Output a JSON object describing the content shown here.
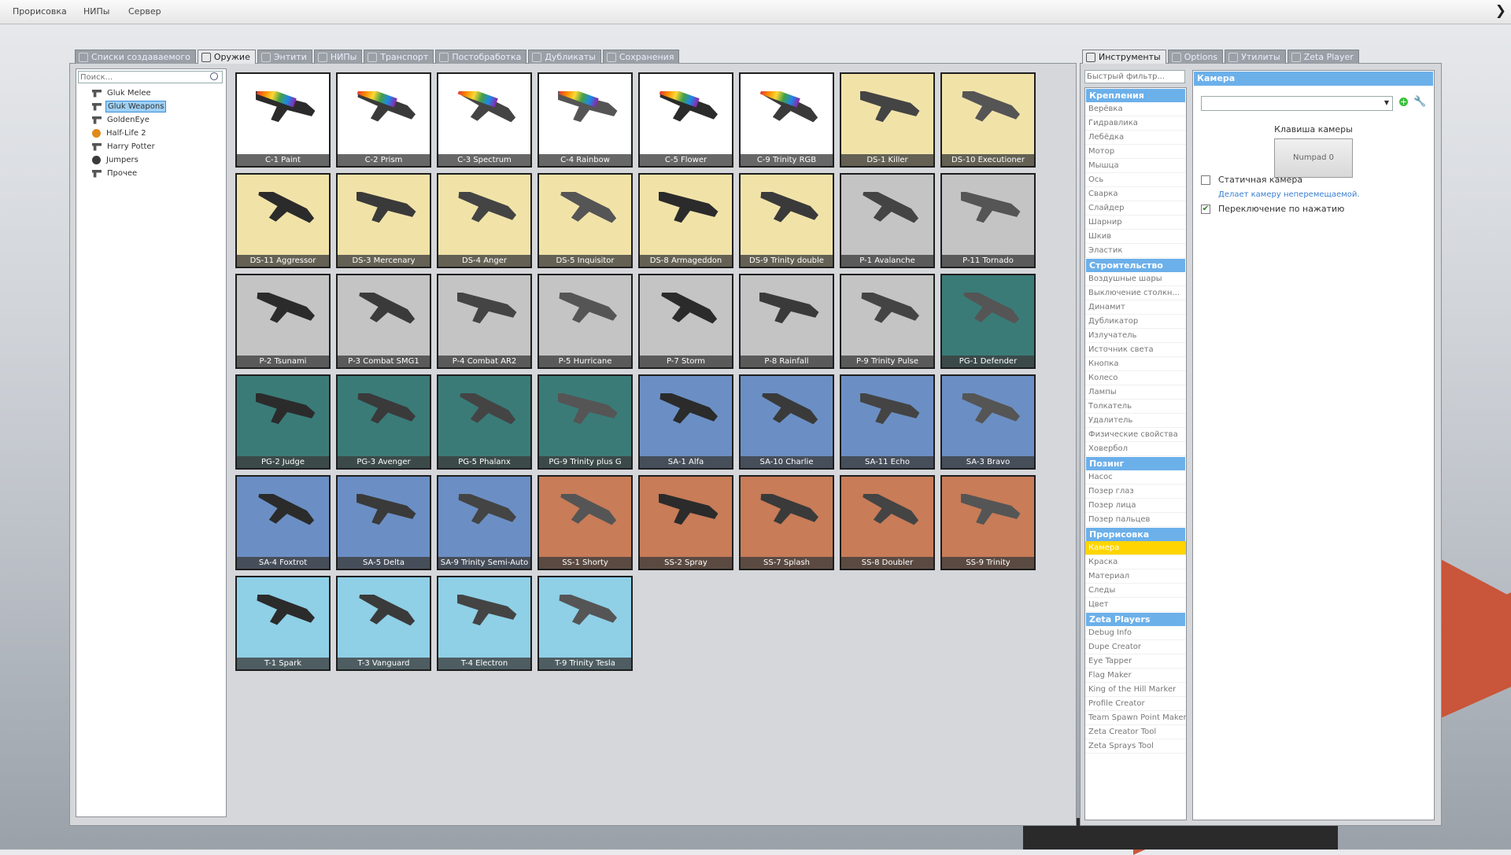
{
  "menubar": {
    "items": [
      "Прорисовка",
      "НИПы",
      "Сервер"
    ]
  },
  "spawnmenu": {
    "tabs": [
      "Списки создаваемого",
      "Оружие",
      "Энтити",
      "НИПы",
      "Транспорт",
      "Постобработка",
      "Дубликаты",
      "Сохранения"
    ],
    "active_tab": "Оружие",
    "search_placeholder": "Поиск...",
    "tree": [
      {
        "label": "Gluk Melee",
        "icon": "gun-icon"
      },
      {
        "label": "Gluk Weapons",
        "icon": "gun-icon",
        "selected": true
      },
      {
        "label": "GoldenEye",
        "icon": "gun-icon"
      },
      {
        "label": "Half-Life 2",
        "icon": "lambda-icon"
      },
      {
        "label": "Harry Potter",
        "icon": "gun-icon"
      },
      {
        "label": "Jumpers",
        "icon": "bomb-icon"
      },
      {
        "label": "Прочее",
        "icon": "gun-icon"
      }
    ],
    "weapons": [
      {
        "name": "C-1 Paint",
        "bg": "#ffffff"
      },
      {
        "name": "C-2 Prism",
        "bg": "#ffffff"
      },
      {
        "name": "C-3 Spectrum",
        "bg": "#ffffff"
      },
      {
        "name": "C-4 Rainbow",
        "bg": "#ffffff"
      },
      {
        "name": "C-5 Flower",
        "bg": "#ffffff"
      },
      {
        "name": "C-9 Trinity RGB",
        "bg": "#ffffff"
      },
      {
        "name": "DS-1 Killer",
        "bg": "#f1e3a8"
      },
      {
        "name": "DS-10 Executioner",
        "bg": "#f1e3a8"
      },
      {
        "name": "DS-11 Aggressor",
        "bg": "#f1e3a8"
      },
      {
        "name": "DS-3 Mercenary",
        "bg": "#f1e3a8"
      },
      {
        "name": "DS-4 Anger",
        "bg": "#f1e3a8"
      },
      {
        "name": "DS-5 Inquisitor",
        "bg": "#f1e3a8"
      },
      {
        "name": "DS-8 Armageddon",
        "bg": "#f1e3a8"
      },
      {
        "name": "DS-9 Trinity double",
        "bg": "#f1e3a8"
      },
      {
        "name": "P-1 Avalanche",
        "bg": "#c4c4c4"
      },
      {
        "name": "P-11 Tornado",
        "bg": "#c4c4c4"
      },
      {
        "name": "P-2 Tsunami",
        "bg": "#c4c4c4"
      },
      {
        "name": "P-3 Combat SMG1",
        "bg": "#c4c4c4"
      },
      {
        "name": "P-4 Combat AR2",
        "bg": "#c4c4c4"
      },
      {
        "name": "P-5 Hurricane",
        "bg": "#c4c4c4"
      },
      {
        "name": "P-7 Storm",
        "bg": "#c4c4c4"
      },
      {
        "name": "P-8 Rainfall",
        "bg": "#c4c4c4"
      },
      {
        "name": "P-9 Trinity Pulse",
        "bg": "#c4c4c4"
      },
      {
        "name": "PG-1 Defender",
        "bg": "#3a7b78"
      },
      {
        "name": "PG-2 Judge",
        "bg": "#3a7b78"
      },
      {
        "name": "PG-3 Avenger",
        "bg": "#3a7b78"
      },
      {
        "name": "PG-5 Phalanx",
        "bg": "#3a7b78"
      },
      {
        "name": "PG-9 Trinity plus G",
        "bg": "#3a7b78"
      },
      {
        "name": "SA-1 Alfa",
        "bg": "#6b8fc4"
      },
      {
        "name": "SA-10 Charlie",
        "bg": "#6b8fc4"
      },
      {
        "name": "SA-11 Echo",
        "bg": "#6b8fc4"
      },
      {
        "name": "SA-3 Bravo",
        "bg": "#6b8fc4"
      },
      {
        "name": "SA-4 Foxtrot",
        "bg": "#6b8fc4"
      },
      {
        "name": "SA-5 Delta",
        "bg": "#6b8fc4"
      },
      {
        "name": "SA-9 Trinity Semi-Auto",
        "bg": "#6b8fc4"
      },
      {
        "name": "SS-1 Shorty",
        "bg": "#c87c58"
      },
      {
        "name": "SS-2 Spray",
        "bg": "#c87c58"
      },
      {
        "name": "SS-7 Splash",
        "bg": "#c87c58"
      },
      {
        "name": "SS-8 Doubler",
        "bg": "#c87c58"
      },
      {
        "name": "SS-9 Trinity",
        "bg": "#c87c58"
      },
      {
        "name": "T-1 Spark",
        "bg": "#8fd0e6"
      },
      {
        "name": "T-3 Vanguard",
        "bg": "#8fd0e6"
      },
      {
        "name": "T-4 Electron",
        "bg": "#8fd0e6"
      },
      {
        "name": "T-9 Trinity Tesla",
        "bg": "#8fd0e6"
      }
    ]
  },
  "toolmenu": {
    "tabs": [
      "Инструменты",
      "Options",
      "Утилиты",
      "Zeta Player"
    ],
    "active_tab": "Инструменты",
    "filter_placeholder": "Быстрый фильтр...",
    "categories": [
      {
        "title": "Крепления",
        "items": [
          "Верёвка",
          "Гидравлика",
          "Лебёдка",
          "Мотор",
          "Мышца",
          "Ось",
          "Сварка",
          "Слайдер",
          "Шарнир",
          "Шкив",
          "Эластик"
        ]
      },
      {
        "title": "Строительство",
        "items": [
          "Воздушные шары",
          "Выключение столкн...",
          "Динамит",
          "Дубликатор",
          "Излучатель",
          "Источник света",
          "Кнопка",
          "Колесо",
          "Лампы",
          "Толкатель",
          "Удалитель",
          "Физические свойства",
          "Ховербол"
        ]
      },
      {
        "title": "Позинг",
        "items": [
          "Насос",
          "Позер глаз",
          "Позер лица",
          "Позер пальцев"
        ]
      },
      {
        "title": "Прорисовка",
        "items": [
          "Камера",
          "Краска",
          "Материал",
          "Следы",
          "Цвет"
        ]
      },
      {
        "title": "Zeta Players",
        "items": [
          "Debug Info",
          "Dupe Creator",
          "Eye Tapper",
          "Flag Maker",
          "King of the Hill Marker",
          "Profile Creator",
          "Team Spawn Point Maker",
          "Zeta Creator Tool",
          "Zeta Sprays Tool"
        ]
      }
    ],
    "selected_item": "Камера",
    "panel": {
      "title": "Камера",
      "key_label": "Клавиша камеры",
      "key_value": "Numpad 0",
      "static_label": "Статичная камера",
      "static_hint": "Делает камеру неперемещаемой.",
      "toggle_label": "Переключение по нажатию",
      "static_checked": false,
      "toggle_checked": true
    }
  },
  "colors": {
    "header_blue": "#6cb0ea",
    "selection_yellow": "#ffd400",
    "link_blue": "#3a7fd0"
  }
}
